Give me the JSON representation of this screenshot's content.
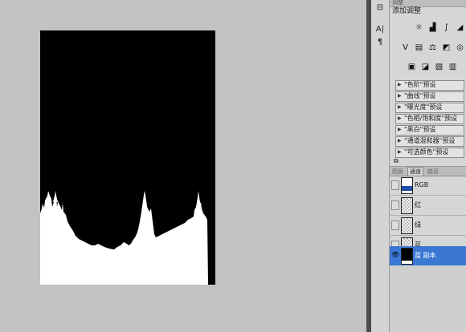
{
  "adjustments_panel": {
    "tab_label": "调整",
    "title": "添加调整",
    "icon_rows": [
      [
        "brightness-contrast-icon",
        "levels-icon",
        "curves-icon",
        "exposure-icon"
      ],
      [
        "vibrance-icon",
        "hue-saturation-icon",
        "color-balance-icon",
        "black-white-icon",
        "photo-filter-icon"
      ],
      [
        "channel-mixer-icon",
        "invert-icon",
        "posterize-icon",
        "threshold-icon"
      ]
    ],
    "presets": [
      "\"色阶\"预设",
      "\"曲线\"预设",
      "\"曝光度\"预设",
      "\"色相/饱和度\"预设",
      "\"黑白\"预设",
      "\"通道混和器\"预设",
      "\"可选颜色\"预设"
    ]
  },
  "left_tools": [
    "character-icon",
    "paragraph-icon"
  ],
  "tabs": [
    {
      "label": "图层",
      "active": false
    },
    {
      "label": "通道",
      "active": true
    },
    {
      "label": "路径",
      "active": false
    }
  ],
  "channels": [
    {
      "label": "RGB",
      "visible": false,
      "selected": false
    },
    {
      "label": "红",
      "visible": false,
      "selected": false
    },
    {
      "label": "绿",
      "visible": false,
      "selected": false
    },
    {
      "label": "蓝",
      "visible": false,
      "selected": false
    },
    {
      "label": "蓝 副本",
      "visible": true,
      "selected": true
    }
  ],
  "colors": {
    "workspace": "#c2c2c2",
    "selection": "#3a78d4",
    "document_background": "#000000",
    "mask_foreground": "#ffffff"
  }
}
